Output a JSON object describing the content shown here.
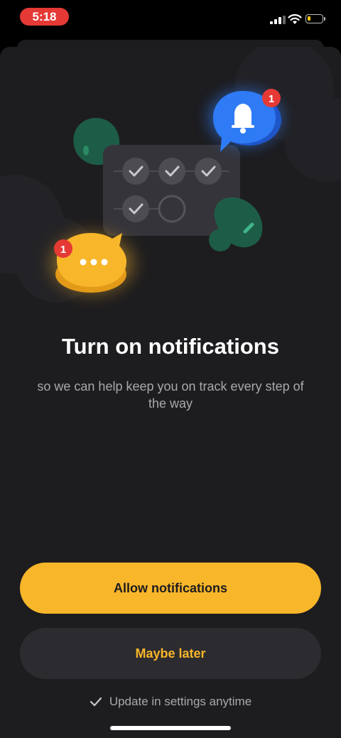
{
  "status_bar": {
    "time": "5:18",
    "icons": [
      "signal-icon",
      "wifi-icon",
      "battery-icon"
    ]
  },
  "illustration": {
    "bell_badge_count": "1",
    "chat_badge_count": "1",
    "icons": [
      "bell-icon",
      "chat-bubble-icon",
      "checkmark-icon",
      "plant-icon"
    ]
  },
  "content": {
    "title": "Turn on notifications",
    "subtitle": "so we can help keep you on track every step of the way"
  },
  "actions": {
    "allow_label": "Allow notifications",
    "later_label": "Maybe later"
  },
  "footer": {
    "note": "Update in settings anytime",
    "note_icon": "checkmark-icon"
  },
  "colors": {
    "accent": "#f8b62a",
    "background": "#1d1c1f",
    "secondary_button": "#2c2b2f",
    "badge": "#e53935",
    "bell_bubble": "#2f7bf5",
    "plant": "#1d5c46"
  }
}
